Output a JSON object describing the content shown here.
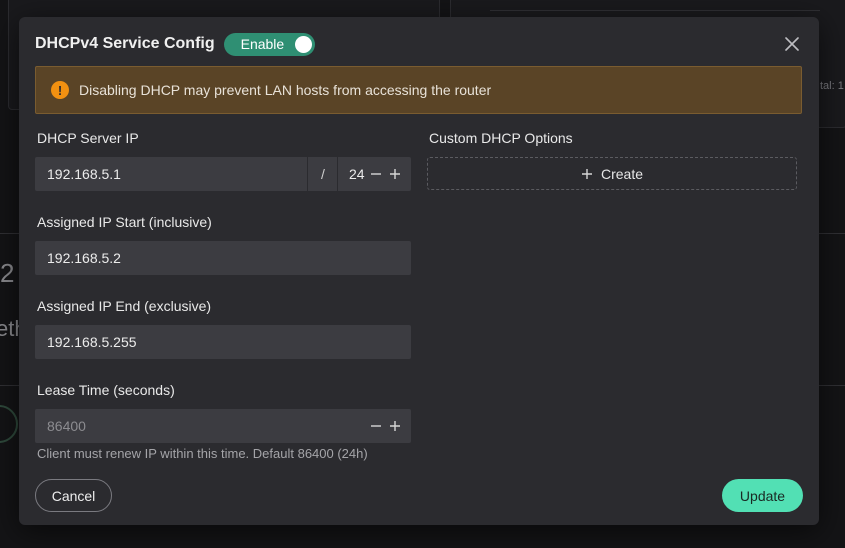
{
  "background": {
    "partial_total": "tal: 1",
    "partial_number": "2",
    "partial_text": "eth"
  },
  "modal": {
    "title": "DHCPv4 Service Config",
    "toggle_label": "Enable",
    "toggle_on": true,
    "alert_text": "Disabling DHCP may prevent LAN hosts from accessing the router",
    "alert_icon": "!",
    "server_ip": {
      "label": "DHCP Server IP",
      "value": "192.168.5.1",
      "separator": "/",
      "prefix": "24"
    },
    "ip_start": {
      "label": "Assigned IP Start (inclusive)",
      "value": "192.168.5.2"
    },
    "ip_end": {
      "label": "Assigned IP End (exclusive)",
      "value": "192.168.5.255"
    },
    "lease": {
      "label": "Lease Time (seconds)",
      "placeholder": "86400",
      "helper": "Client must renew IP within this time. Default 86400 (24h)"
    },
    "custom_options": {
      "label": "Custom DHCP Options",
      "create_label": "Create"
    },
    "cancel_label": "Cancel",
    "update_label": "Update"
  },
  "colors": {
    "accent": "#52e0b4",
    "toggle": "#2f8f73",
    "warning": "#f29111",
    "alert_bg": "#5a4426"
  }
}
